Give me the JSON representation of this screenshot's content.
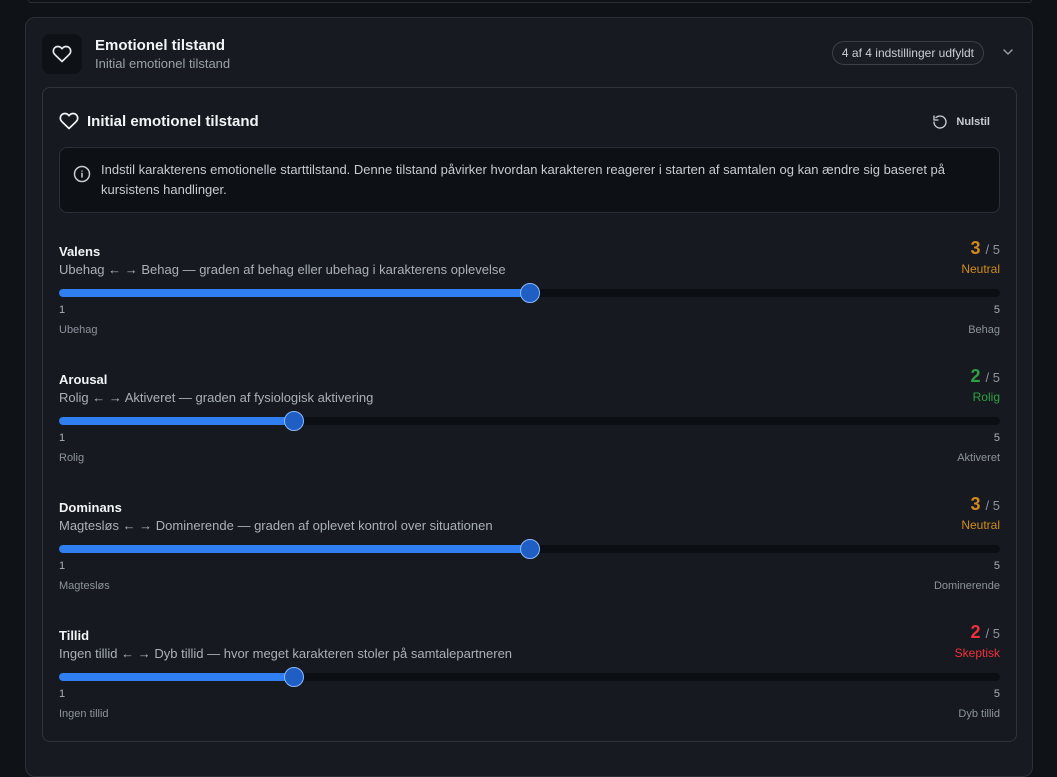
{
  "section": {
    "title": "Emotionel tilstand",
    "subtitle": "Initial emotionel tilstand",
    "badge": "4 af 4 indstillinger udfyldt"
  },
  "panel": {
    "title": "Initial emotionel tilstand",
    "reset_label": "Nulstil",
    "info_text": "Indstil karakterens emotionelle starttilstand. Denne tilstand påvirker hvordan karakteren reagerer i starten af samtalen og kan ændre sig baseret på kursistens handlinger."
  },
  "sliders": [
    {
      "label": "Valens",
      "description": "Ubehag ← → Behag — graden af behag eller ubehag i karakterens oplevelse",
      "value": "3",
      "max_text": "/ 5",
      "value_num": 3,
      "status": "Neutral",
      "color": "#d08a1e",
      "min_tick": "1",
      "max_tick": "5",
      "min_label": "Ubehag",
      "max_label": "Behag"
    },
    {
      "label": "Arousal",
      "description": "Rolig ← → Aktiveret — graden af fysiologisk aktivering",
      "value": "2",
      "max_text": "/ 5",
      "value_num": 2,
      "status": "Rolig",
      "color": "#2ea043",
      "min_tick": "1",
      "max_tick": "5",
      "min_label": "Rolig",
      "max_label": "Aktiveret"
    },
    {
      "label": "Dominans",
      "description": "Magtesløs ← → Dominerende — graden af oplevet kontrol over situationen",
      "value": "3",
      "max_text": "/ 5",
      "value_num": 3,
      "status": "Neutral",
      "color": "#d08a1e",
      "min_tick": "1",
      "max_tick": "5",
      "min_label": "Magtesløs",
      "max_label": "Dominerende"
    },
    {
      "label": "Tillid",
      "description": "Ingen tillid ← → Dyb tillid — hvor meget karakteren stoler på samtalepartneren",
      "value": "2",
      "max_text": "/ 5",
      "value_num": 2,
      "status": "Skeptisk",
      "color": "#f0303a",
      "min_tick": "1",
      "max_tick": "5",
      "min_label": "Ingen tillid",
      "max_label": "Dyb tillid"
    }
  ]
}
